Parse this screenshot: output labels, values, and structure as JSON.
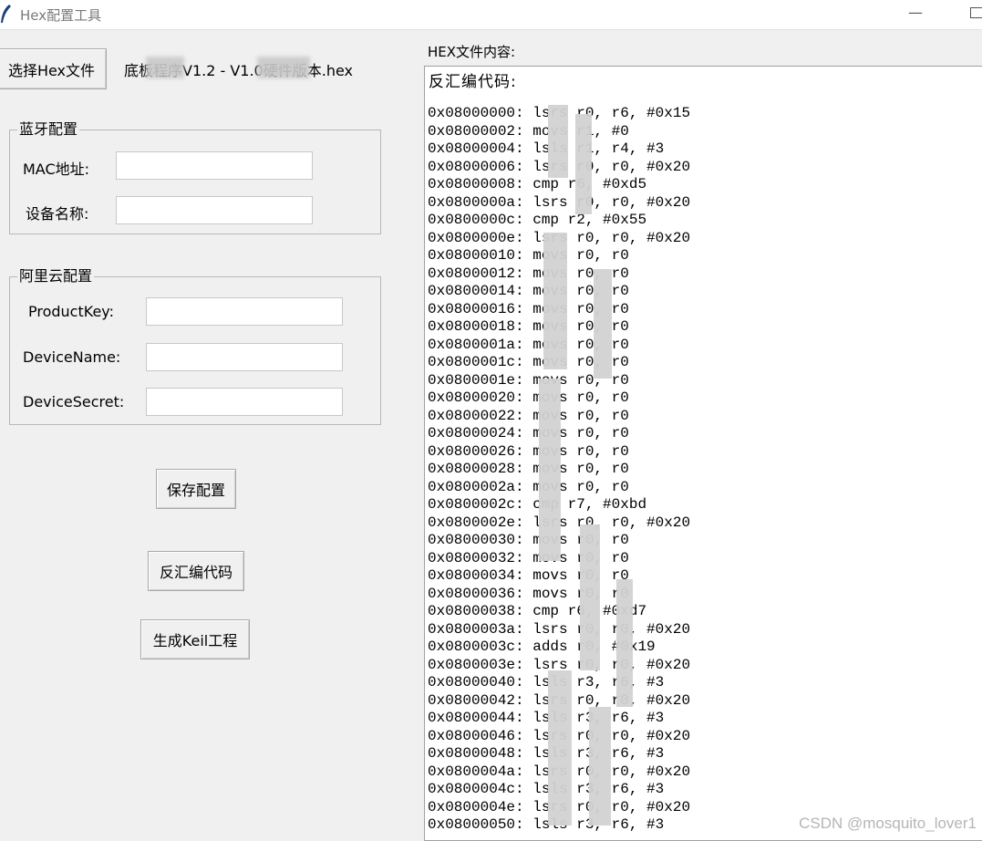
{
  "window": {
    "title": "Hex配置工具",
    "minimize_glyph": "—"
  },
  "toolbar": {
    "select_hex_button": "选择Hex文件",
    "file_name": "底板程序V1.2 - V1.0硬件版本.hex"
  },
  "bluetooth": {
    "group_title": "蓝牙配置",
    "mac_label": "MAC地址:",
    "mac_value": "",
    "device_name_label": "设备名称:",
    "device_name_value": ""
  },
  "aliyun": {
    "group_title": "阿里云配置",
    "product_key_label": "ProductKey:",
    "product_key_value": "",
    "device_name_label": "DeviceName:",
    "device_name_value": "",
    "device_secret_label": "DeviceSecret:",
    "device_secret_value": ""
  },
  "actions": {
    "save_config": "保存配置",
    "disassemble": "反汇编代码",
    "generate_keil": "生成Keil工程"
  },
  "hex_panel": {
    "label": "HEX文件内容:",
    "heading": "反汇编代码:",
    "lines": [
      "0x08000000: lsrs r0, r6, #0x15",
      "0x08000002: movs r1, #0",
      "0x08000004: lsls r1, r4, #3",
      "0x08000006: lsrs r0, r0, #0x20",
      "0x08000008: cmp r6, #0xd5",
      "0x0800000a: lsrs r0, r0, #0x20",
      "0x0800000c: cmp r2, #0x55",
      "0x0800000e: lsrs r0, r0, #0x20",
      "0x08000010: movs r0, r0",
      "0x08000012: movs r0, r0",
      "0x08000014: movs r0, r0",
      "0x08000016: movs r0, r0",
      "0x08000018: movs r0, r0",
      "0x0800001a: movs r0, r0",
      "0x0800001c: movs r0, r0",
      "0x0800001e: movs r0, r0",
      "0x08000020: movs r0, r0",
      "0x08000022: movs r0, r0",
      "0x08000024: movs r0, r0",
      "0x08000026: movs r0, r0",
      "0x08000028: movs r0, r0",
      "0x0800002a: movs r0, r0",
      "0x0800002c: cmp r7, #0xbd",
      "0x0800002e: lsrs r0, r0, #0x20",
      "0x08000030: movs r0, r0",
      "0x08000032: movs r0, r0",
      "0x08000034: movs r0, r0",
      "0x08000036: movs r0, r0",
      "0x08000038: cmp r6, #0xd7",
      "0x0800003a: lsrs r0, r0, #0x20",
      "0x0800003c: adds r0, #0x19",
      "0x0800003e: lsrs r0, r0, #0x20",
      "0x08000040: lsls r3, r6, #3",
      "0x08000042: lsrs r0, r0, #0x20",
      "0x08000044: lsls r3, r6, #3",
      "0x08000046: lsrs r0, r0, #0x20",
      "0x08000048: lsls r3, r6, #3",
      "0x0800004a: lsrs r0, r0, #0x20",
      "0x0800004c: lsls r3, r6, #3",
      "0x0800004e: lsrs r0, r0, #0x20",
      "0x08000050: lsls r3, r6, #3"
    ]
  },
  "watermark": "CSDN @mosquito_lover1"
}
